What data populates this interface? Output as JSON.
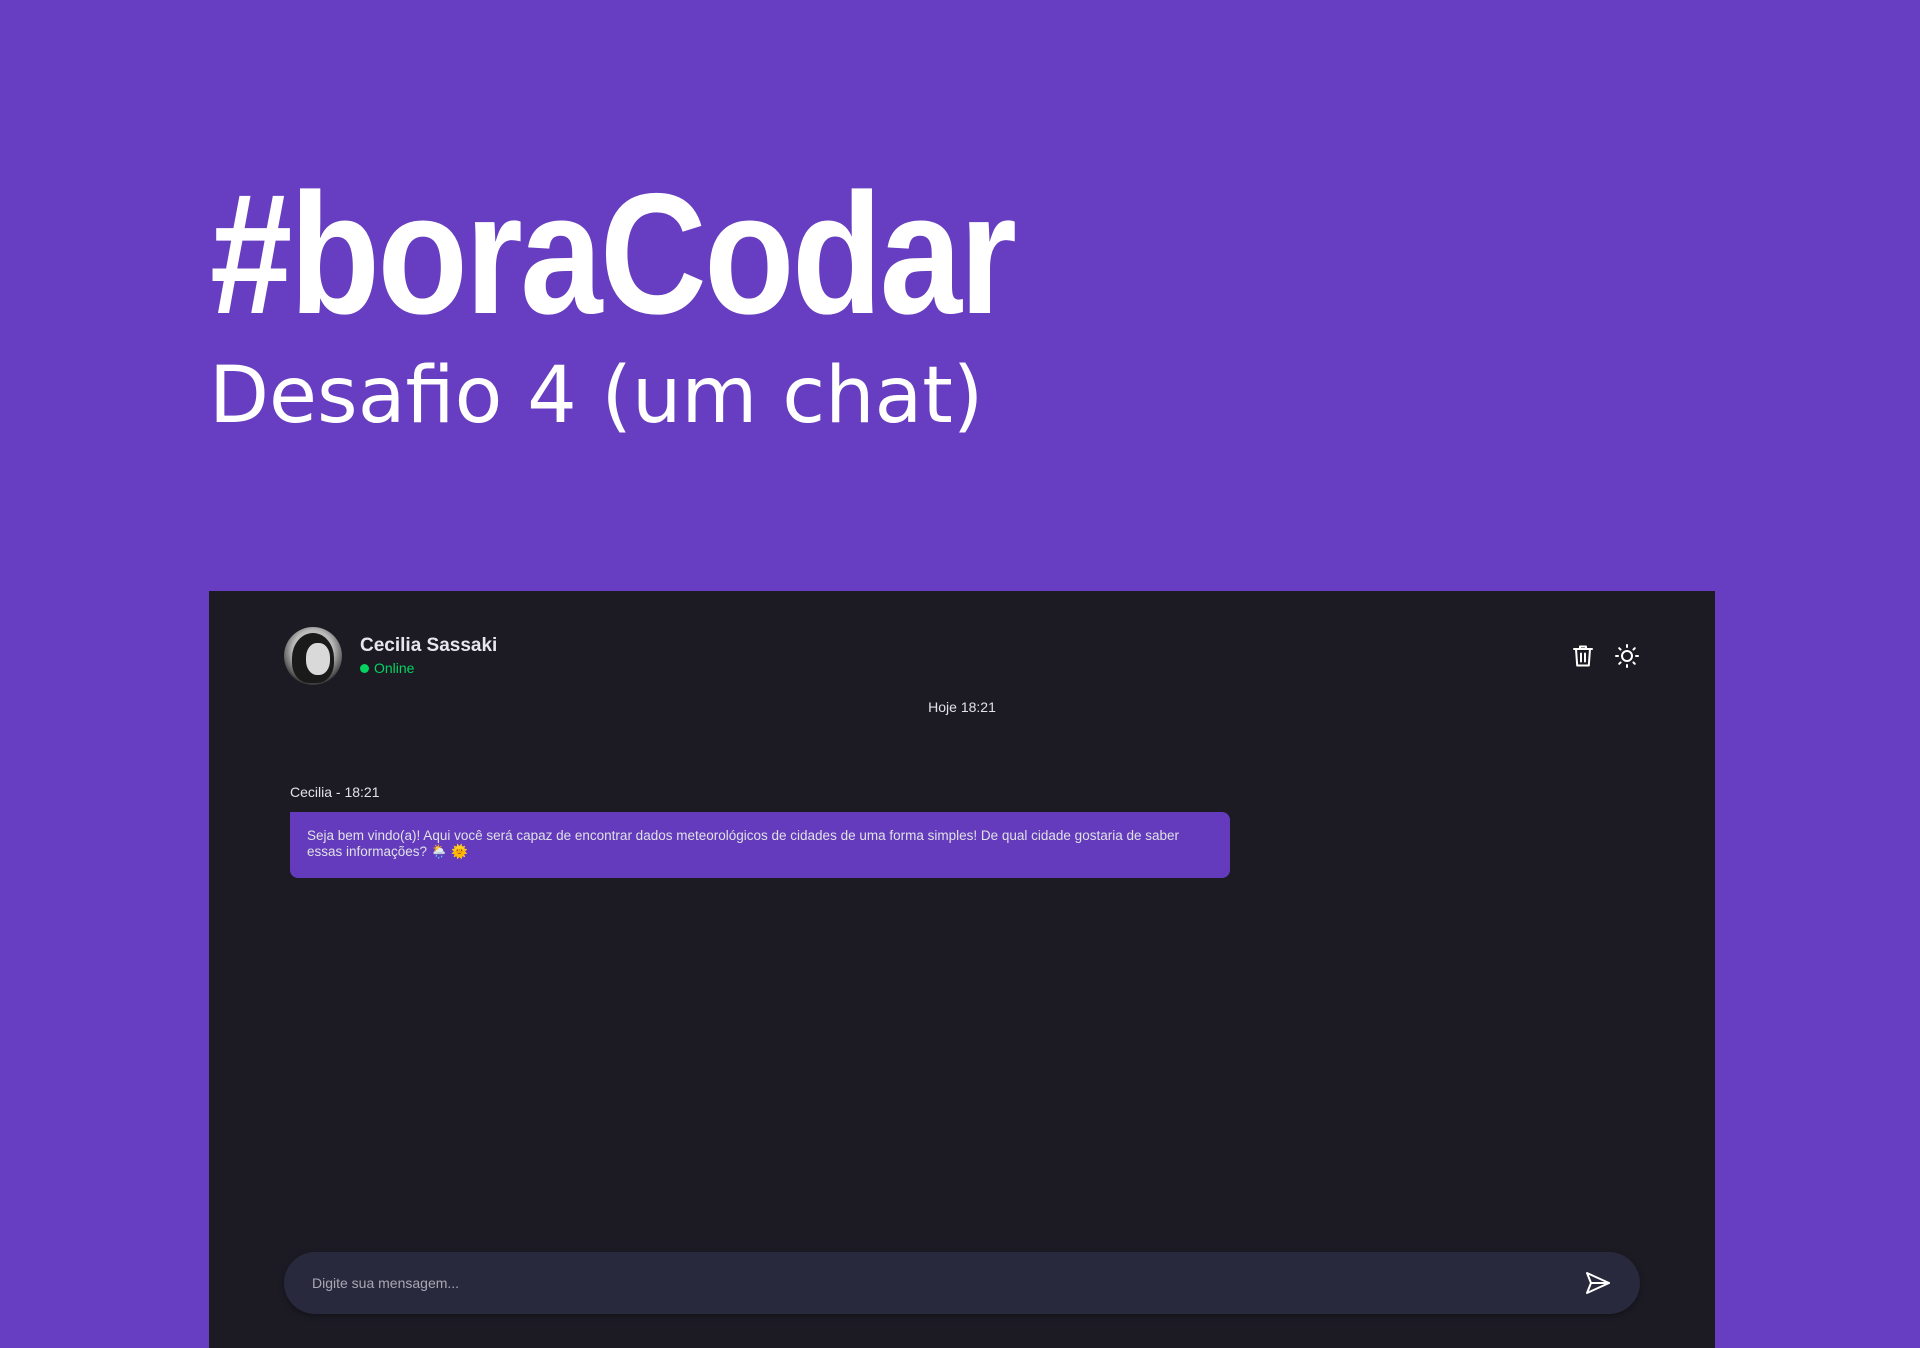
{
  "hero": {
    "title": "#boraCodar",
    "subtitle": "Desafio 4 (um chat)"
  },
  "chat": {
    "contact": {
      "name": "Cecilia Sassaki",
      "status": "Online",
      "avatar_icon": "user-avatar-photo"
    },
    "actions": [
      {
        "name": "delete",
        "icon": "trash-icon"
      },
      {
        "name": "toggle-theme",
        "icon": "sun-icon"
      }
    ],
    "date_divider": "Hoje 18:21",
    "messages": [
      {
        "meta": "Cecilia - 18:21",
        "text": "Seja bem vindo(a)! Aqui você será capaz de encontrar dados meteorológicos de cidades de uma forma simples! De qual cidade gostaria de saber essas informações? 🌦️ 🌞"
      }
    ],
    "composer": {
      "placeholder": "Digite sua mensagem...",
      "value": "",
      "send_icon": "send-icon"
    }
  },
  "colors": {
    "page_background": "#673ec1",
    "chat_background": "#1c1b24",
    "bubble": "#633bbc",
    "composer": "#29293e",
    "online": "#04d361",
    "text": "#e1e1e6"
  }
}
